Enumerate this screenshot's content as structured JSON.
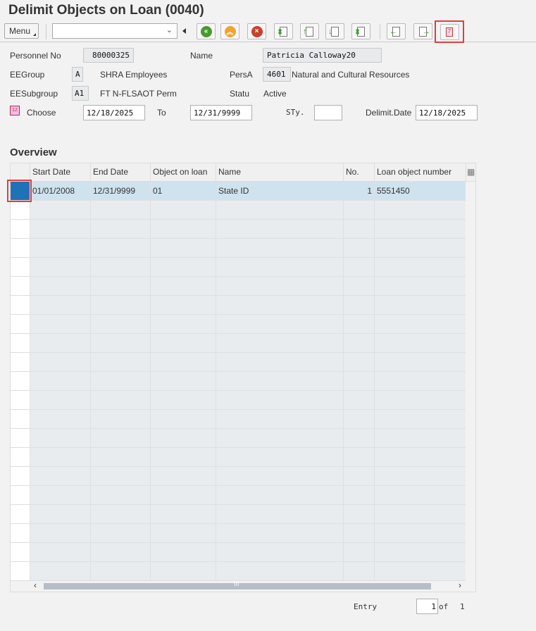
{
  "title": "Delimit Objects on Loan (0040)",
  "toolbar": {
    "menu_label": "Menu",
    "command_value": "",
    "buttons": [
      {
        "name": "back-button",
        "icon": "green-back-circle"
      },
      {
        "name": "exit-button",
        "icon": "orange-up-circle"
      },
      {
        "name": "cancel-button",
        "icon": "red-x-circle"
      },
      {
        "name": "first-page-button",
        "icon": "doc-up-down"
      },
      {
        "name": "previous-page-button",
        "icon": "doc-up"
      },
      {
        "name": "next-page-button",
        "icon": "doc-down"
      },
      {
        "name": "last-page-button",
        "icon": "doc-down-end"
      },
      {
        "name": "previous-record-button",
        "icon": "doc-left"
      },
      {
        "name": "next-record-button",
        "icon": "doc-right"
      },
      {
        "name": "delimit-button",
        "icon": "delimit-calendar"
      }
    ]
  },
  "header": {
    "personnel_no_label": "Personnel No",
    "personnel_no": "80000325",
    "name_label": "Name",
    "name": "Patricia Calloway20",
    "eegroup_label": "EEGroup",
    "eegroup": "A",
    "eegroup_text": "SHRA Employees",
    "persa_label": "PersA",
    "persa": "4601",
    "persa_text": "Natural and Cultural Resources",
    "eesubgroup_label": "EESubgroup",
    "eesubgroup": "A1",
    "eesubgroup_text": "FT N-FLSAOT Perm",
    "status_label": "Statu",
    "status": "Active",
    "choose_label": "Choose",
    "choose_from": "12/18/2025",
    "to_label": "To",
    "choose_to": "12/31/9999",
    "sty_label": "STy.",
    "sty": "",
    "delimit_label": "Delimit.Date",
    "delimit_date": "12/18/2025"
  },
  "overview": {
    "title": "Overview",
    "columns": [
      "Start Date",
      "End Date",
      "Object on loan",
      "Name",
      "No.",
      "Loan object number"
    ],
    "rows": [
      [
        "01/01/2008",
        "12/31/9999",
        "01",
        "State ID",
        "1",
        "5551450"
      ]
    ]
  },
  "footer": {
    "entry_label": "Entry",
    "entry": "1",
    "of_label": "of",
    "total": "1"
  }
}
